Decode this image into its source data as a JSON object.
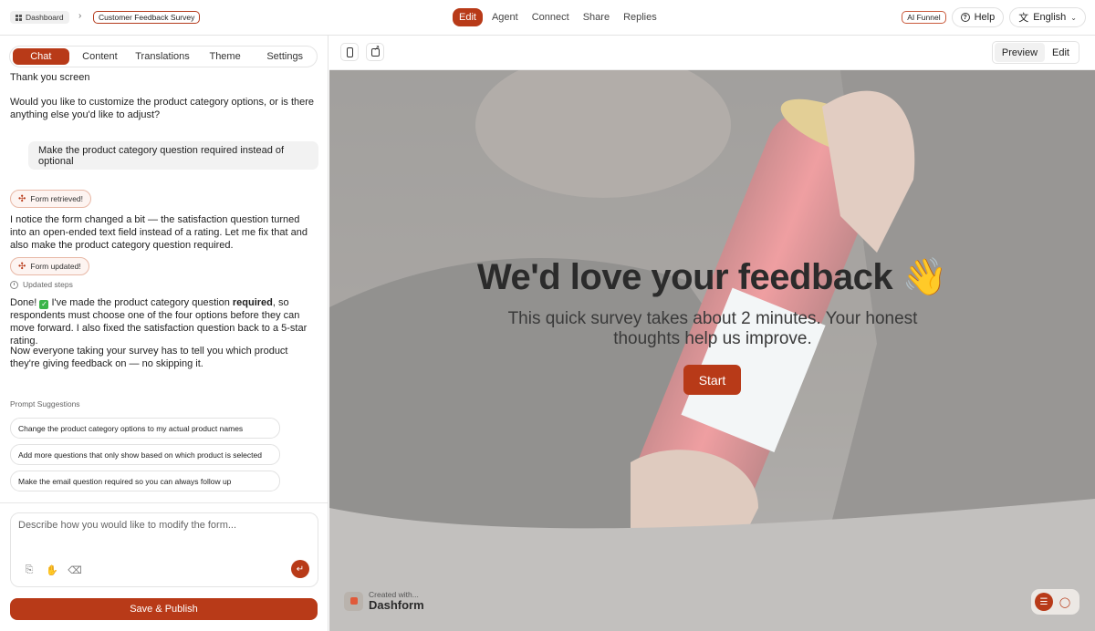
{
  "header": {
    "home_crumb": "Dashboard",
    "crumb_sep": "›",
    "current_crumb": "Customer Feedback Survey",
    "tabs": [
      {
        "label": "Edit"
      },
      {
        "label": "Agent"
      },
      {
        "label": "Connect"
      },
      {
        "label": "Share"
      },
      {
        "label": "Replies"
      }
    ],
    "ai_badge": "AI Funnel",
    "help_label": "Help",
    "language_label": "English"
  },
  "left_panel": {
    "tabs": [
      {
        "label": "Chat"
      },
      {
        "label": "Content"
      },
      {
        "label": "Translations"
      },
      {
        "label": "Theme"
      },
      {
        "label": "Settings"
      }
    ],
    "messages": {
      "thank_you": "Thank you screen",
      "assistant_question": "Would you like to customize the product category options, or is there anything else you'd like to adjust?",
      "user_message": "Make the product category question required instead of optional",
      "form_retrieved": "Form retrieved!",
      "notice": "I notice the form changed a bit — the satisfaction question turned into an open-ended text field instead of a rating. Let me fix that and also make the product category question required.",
      "form_updated": "Form updated!",
      "updated_steps": "Updated steps",
      "done_part1": "Done! ",
      "done_check": "✓",
      "done_part2": " I've made the product category question ",
      "done_bold": "required",
      "done_part3": ", so respondents must choose one of the four options before they can move forward. I also fixed the satisfaction question back to a 5-star rating.",
      "now_everyone": "Now everyone taking your survey has to tell you which product they're giving feedback on — no skipping it."
    },
    "suggestions": {
      "heading": "Prompt Suggestions",
      "items": [
        {
          "label": "Change the product category options to my actual product names"
        },
        {
          "label": "Add more questions that only show based on which product is selected"
        },
        {
          "label": "Make the email question required so you can always follow up"
        }
      ]
    },
    "composer": {
      "placeholder": "Describe how you would like to modify the form...",
      "value": ""
    },
    "publish_label": "Save & Publish"
  },
  "preview": {
    "mode_buttons": [
      {
        "label": "Preview"
      },
      {
        "label": "Edit"
      }
    ],
    "title": "We'd love your feedback 👋",
    "subtitle": "This quick survey takes about 2 minutes. Your honest thoughts help us improve.",
    "start_label": "Start",
    "brand_small": "Created with...",
    "brand_name": "Dashform"
  },
  "icons": {
    "home": "dashboard-grid-icon",
    "help": "help-circle-icon",
    "language": "translate-icon",
    "sparkle": "sparkle-icon",
    "attach": "paperclip-icon",
    "mic": "microphone-icon",
    "eraser": "eraser-icon",
    "send": "send-icon",
    "phone": "mobile-device-icon",
    "open_external": "open-external-icon",
    "list": "list-icon",
    "chat": "chat-bubble-icon"
  },
  "colors": {
    "accent": "#b83a18"
  }
}
